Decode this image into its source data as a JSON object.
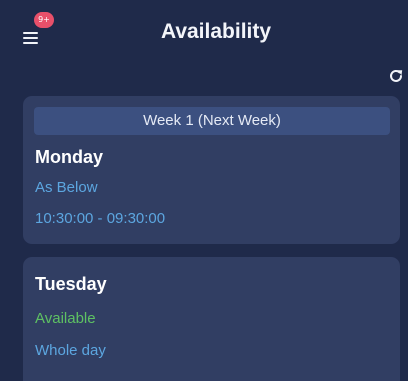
{
  "header": {
    "title": "Availability",
    "notification_badge": "9+",
    "menu_icon": "hamburger-menu-icon",
    "refresh_icon": "refresh-icon"
  },
  "week": {
    "label": "Week 1 (Next Week)"
  },
  "days": [
    {
      "name": "Monday",
      "status": "As Below",
      "time": "10:30:00 - 09:30:00"
    },
    {
      "name": "Tuesday",
      "status": "Available",
      "time": "Whole day"
    }
  ],
  "colors": {
    "background": "#1f2a4a",
    "card": "#313e63",
    "week_header": "#3c5080",
    "blue_text": "#5ca6e0",
    "green_text": "#5ec163",
    "badge": "#e8506a"
  }
}
